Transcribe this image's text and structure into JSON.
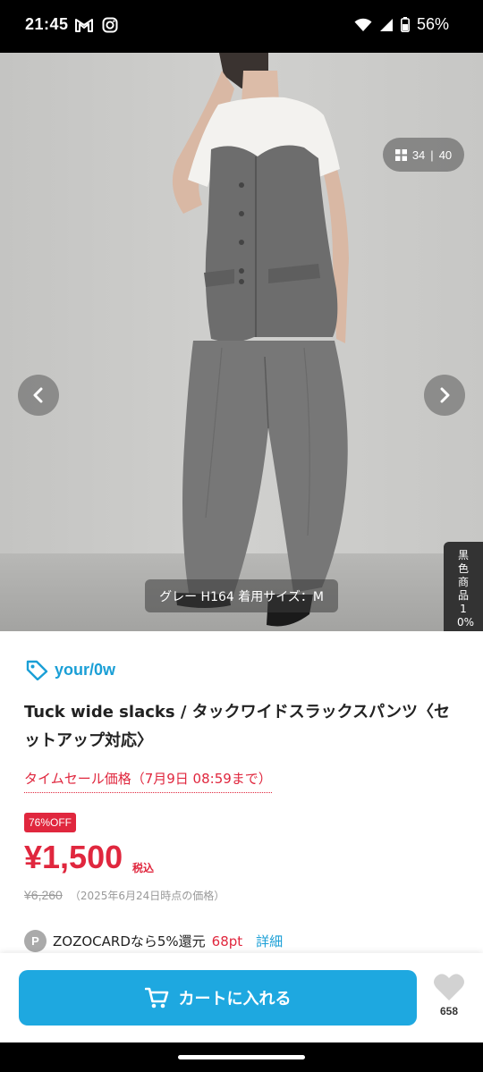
{
  "status_bar": {
    "time": "21:45",
    "notification_icons": [
      "gmail-icon",
      "instagram-icon"
    ],
    "battery": "56%",
    "system_icons": [
      "wifi-icon",
      "signal-icon",
      "battery-icon"
    ]
  },
  "gallery": {
    "current": "34",
    "separator": "|",
    "total": "40",
    "caption": "グレー H164 着用サイズ：M",
    "side_tab": "黒色商品10%"
  },
  "product": {
    "brand": "your/0w",
    "title": "Tuck wide slacks / タックワイドスラックスパンツ〈セットアップ対応〉",
    "sale_label": "タイムセール価格（7月9日 08:59まで）",
    "discount_badge": "76%OFF",
    "price": "¥1,500",
    "tax_label": "税込",
    "original_price": "¥6,260",
    "original_price_note": "（2025年6月24日時点の価格）"
  },
  "points": {
    "icon_letter": "P",
    "text": "ZOZOCARDなら5%還元",
    "value": "68pt",
    "detail_link": "詳細"
  },
  "actions": {
    "cart_button": "カートに入れる",
    "favorite_count": "658"
  },
  "colors": {
    "accent_blue": "#1ea8e0",
    "sale_red": "#e0273e"
  }
}
